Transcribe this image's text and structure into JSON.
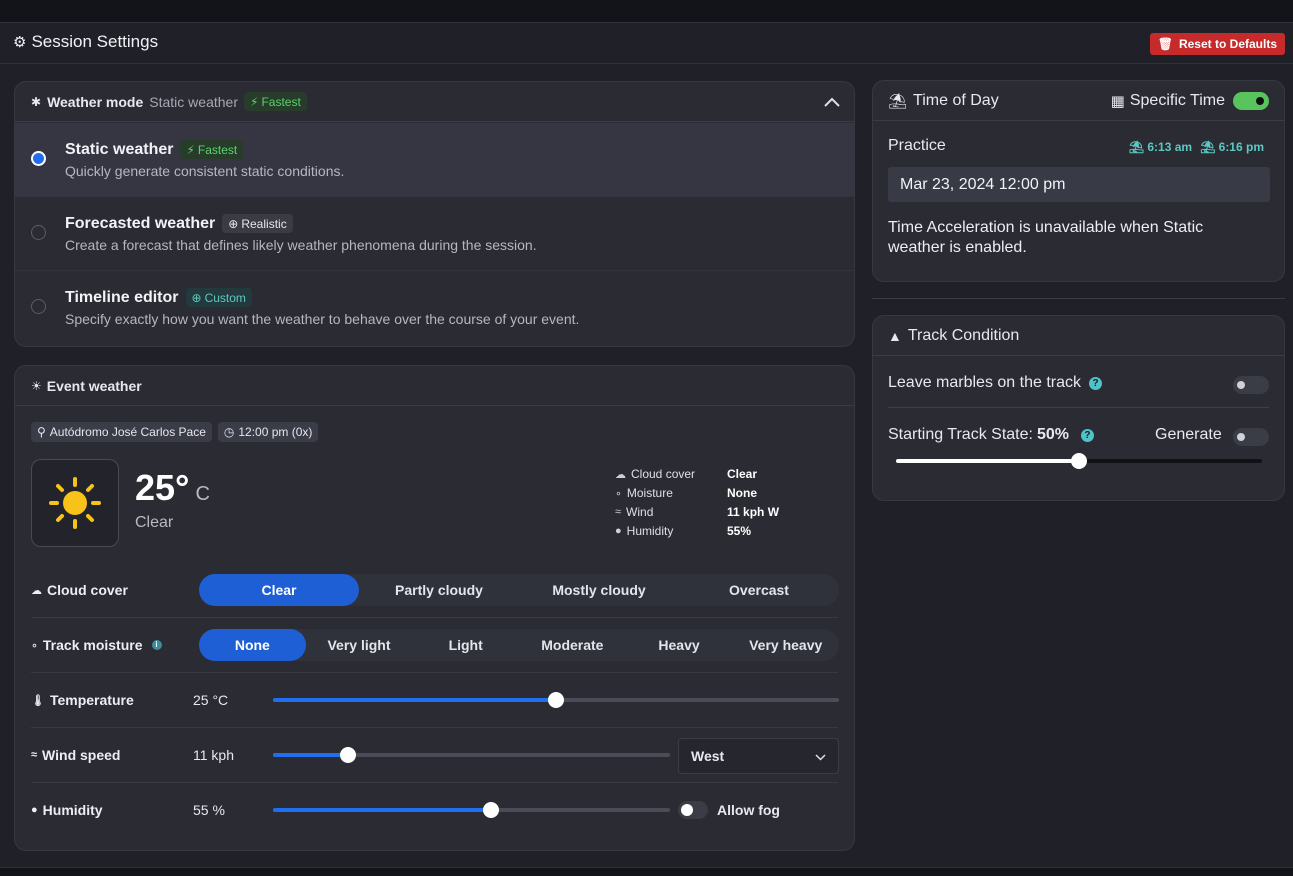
{
  "header": {
    "title": "Session Settings",
    "reset_label": "Reset to Defaults"
  },
  "weather_mode": {
    "label": "Weather mode",
    "current": "Static weather",
    "current_badge": "Fastest",
    "options": [
      {
        "title": "Static weather",
        "badge": "Fastest",
        "desc": "Quickly generate consistent static conditions.",
        "selected": true
      },
      {
        "title": "Forecasted weather",
        "badge": "Realistic",
        "desc": "Create a forecast that defines likely weather phenomena during the session.",
        "selected": false
      },
      {
        "title": "Timeline editor",
        "badge": "Custom",
        "desc": "Specify exactly how you want the weather to behave over the course of your event.",
        "selected": false
      }
    ]
  },
  "event_weather": {
    "label": "Event weather",
    "track": "Autódromo José Carlos Pace",
    "time": "12:00 pm (0x)",
    "temp_value": "25°",
    "temp_unit": "C",
    "condition": "Clear",
    "stats": [
      {
        "key": "Cloud cover",
        "value": "Clear"
      },
      {
        "key": "Moisture",
        "value": "None"
      },
      {
        "key": "Wind",
        "value": "11 kph W"
      },
      {
        "key": "Humidity",
        "value": "55%"
      }
    ],
    "cloud_cover": {
      "label": "Cloud cover",
      "options": [
        "Clear",
        "Partly cloudy",
        "Mostly cloudy",
        "Overcast"
      ],
      "selected": 0
    },
    "track_moisture": {
      "label": "Track moisture",
      "options": [
        "None",
        "Very light",
        "Light",
        "Moderate",
        "Heavy",
        "Very heavy"
      ],
      "selected": 0
    },
    "temperature": {
      "label": "Temperature",
      "value": "25 °C",
      "level": 0.5
    },
    "wind_speed": {
      "label": "Wind speed",
      "value": "11 kph",
      "level": 0.19,
      "direction": "West"
    },
    "humidity": {
      "label": "Humidity",
      "value": "55 %",
      "level": 0.55,
      "fog_label": "Allow fog",
      "fog_on": false
    }
  },
  "time_of_day": {
    "label": "Time of Day",
    "specific_time_label": "Specific Time",
    "specific_time_on": true,
    "session": "Practice",
    "sunrise": "6:13 am",
    "sunset": "6:16 pm",
    "datetime": "Mar 23, 2024 12:00 pm",
    "note": "Time Acceleration is unavailable when Static weather is enabled."
  },
  "track_condition": {
    "label": "Track Condition",
    "marbles_label": "Leave marbles on the track",
    "marbles_on": false,
    "starting_state_label": "Starting Track State:",
    "starting_state_value": "50%",
    "starting_state_level": 0.5,
    "generate_label": "Generate",
    "generate_on": false
  },
  "colors": {
    "accent": "#1f6ff0",
    "danger": "#c62a2a",
    "success": "#59c45d",
    "teal": "#5cc9c4"
  }
}
